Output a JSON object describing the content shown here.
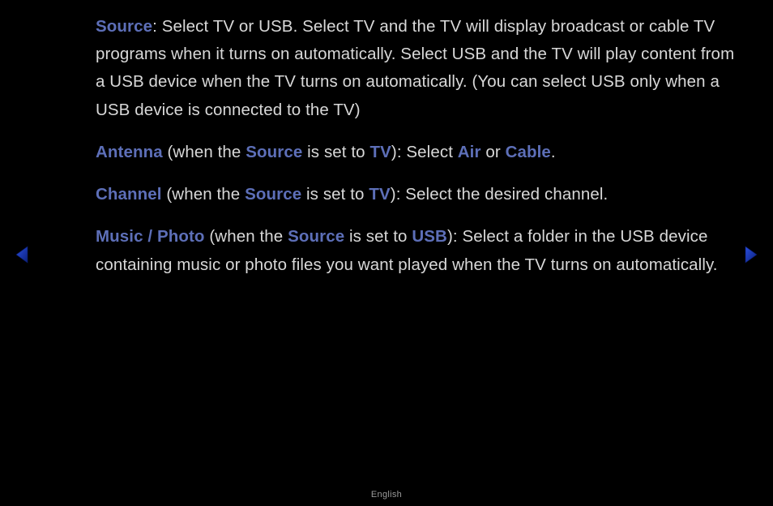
{
  "para1": {
    "hl_source": "Source",
    "rest": ": Select TV or USB. Select TV and the TV will display broadcast or cable TV programs when it turns on automatically. Select USB and the TV will play content from a USB device when the TV turns on automatically. (You can select USB only when a USB device is connected to the TV)"
  },
  "para2": {
    "hl_antenna": "Antenna",
    "t1": " (when the ",
    "hl_source": "Source",
    "t2": " is set to ",
    "hl_tv": "TV",
    "t3": "): Select ",
    "hl_air": "Air",
    "t4": " or ",
    "hl_cable": "Cable",
    "t5": "."
  },
  "para3": {
    "hl_channel": "Channel",
    "t1": " (when the ",
    "hl_source": "Source",
    "t2": " is set to ",
    "hl_tv": "TV",
    "t3": "): Select the desired channel."
  },
  "para4": {
    "hl_music": "Music / Photo",
    "t1": " (when the ",
    "hl_source": "Source",
    "t2": " is set to ",
    "hl_usb": "USB",
    "t3": "): Select a folder in the USB device containing music or photo files you want played when the TV turns on automatically."
  },
  "footer": "English"
}
